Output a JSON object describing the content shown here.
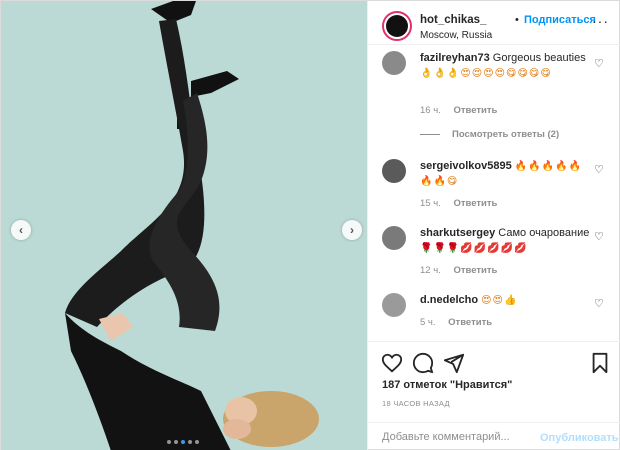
{
  "header": {
    "username": "hot_chikas_",
    "bullet": "•",
    "follow_label": "Подписаться",
    "location": "Moscow, Russia",
    "more_label": "···"
  },
  "comments": [
    {
      "username": "fazilreyhan73",
      "text": "Gorgeous beauties",
      "emoji": "👌👌👌😍😍😍😍😋😋😋😋",
      "time": "16 ч.",
      "reply_label": "Ответить",
      "view_replies": "Посмотреть ответы (2)"
    },
    {
      "username": "sergeivolkov5895",
      "text": "",
      "emoji": "🔥🔥🔥🔥🔥🔥🔥😋",
      "time": "15 ч.",
      "reply_label": "Ответить"
    },
    {
      "username": "sharkutsergey",
      "text": "Само очарование",
      "emoji": "🌹🌹🌹💋💋💋💋💋",
      "time": "12 ч.",
      "reply_label": "Ответить"
    },
    {
      "username": "d.nedelcho",
      "text": "",
      "emoji": "😍😍👍",
      "time": "5 ч.",
      "reply_label": "Ответить"
    }
  ],
  "actions": {
    "likes": "187 отметок \"Нравится\"",
    "time_ago": "18 ЧАСОВ НАЗАД",
    "comment_placeholder": "Добавьте комментарий...",
    "publish_label": "Опубликовать"
  },
  "carousel": {
    "prev_label": "‹",
    "next_label": "›",
    "dot_count": 5,
    "active_dot": 2
  },
  "colors": {
    "link_blue": "#0095f6",
    "publish_disabled": "#b2dffc",
    "photo_background": "#b9d9d5",
    "stockings": "#1b1b1b"
  },
  "icons": {
    "like": "heart-icon",
    "comment": "speech-bubble-icon",
    "share": "paper-plane-icon",
    "save": "bookmark-icon"
  }
}
